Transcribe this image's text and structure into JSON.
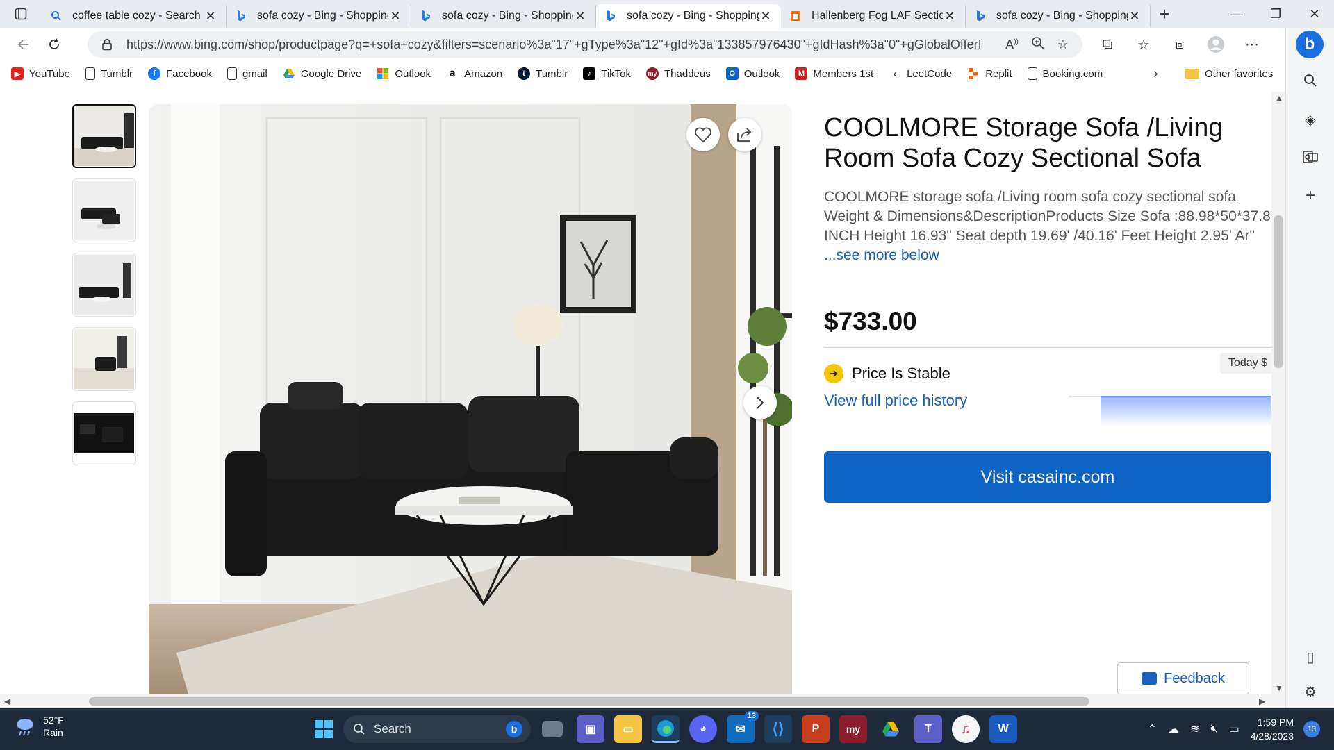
{
  "browser": {
    "tabs": [
      {
        "label": "coffee table cozy - Search",
        "icon": "search-icon"
      },
      {
        "label": "sofa cozy - Bing - Shopping",
        "icon": "bing-icon"
      },
      {
        "label": "sofa cozy - Bing - Shopping",
        "icon": "bing-icon"
      },
      {
        "label": "sofa cozy - Bing - Shopping",
        "icon": "bing-icon",
        "active": true
      },
      {
        "label": "Hallenberg Fog LAF Section",
        "icon": "store-icon"
      },
      {
        "label": "sofa cozy - Bing - Shopping",
        "icon": "bing-icon"
      }
    ],
    "url": "https://www.bing.com/shop/productpage?q=+sofa+cozy&filters=scenario%3a\"17\"+gType%3a\"12\"+gId%3a\"133857976430\"+gIdHash%3a\"0\"+gGlobalOfferI...",
    "favorites": [
      {
        "label": "YouTube",
        "color": "#e62117"
      },
      {
        "label": "Tumblr",
        "color": "#ffffff"
      },
      {
        "label": "Facebook",
        "color": "#1877f2"
      },
      {
        "label": "gmail",
        "color": "#ffffff"
      },
      {
        "label": "Google Drive",
        "color": "#1fa463"
      },
      {
        "label": "Outlook",
        "color": "#f25022"
      },
      {
        "label": "Amazon",
        "color": "#ffffff"
      },
      {
        "label": "Tumblr",
        "color": "#001935"
      },
      {
        "label": "TikTok",
        "color": "#000000"
      },
      {
        "label": "Thaddeus",
        "color": "#8b1d2c"
      },
      {
        "label": "Outlook",
        "color": "#0a64c8"
      },
      {
        "label": "Members 1st",
        "color": "#c81e1e"
      },
      {
        "label": "LeetCode",
        "color": "#ffffff"
      },
      {
        "label": "Replit",
        "color": "#f26207"
      },
      {
        "label": "Booking.com",
        "color": "#ffffff"
      }
    ],
    "other_favorites": "Other favorites"
  },
  "product": {
    "title": "COOLMORE Storage Sofa /Living Room Sofa Cozy Sectional Sofa",
    "description": "COOLMORE storage sofa /Living room sofa cozy sectional sofa Weight & Dimensions&DescriptionProducts Size Sofa :88.98*50*37.8 INCH Height 16.93\" Seat depth 19.69' /40.16' Feet Height 2.95' Ar\" ",
    "see_more": "...see more below",
    "price": "$733.00",
    "price_status": "Price Is Stable",
    "today_label": "Today $",
    "history_link": "View full price history",
    "visit_button": "Visit casainc.com"
  },
  "feedback": "Feedback",
  "taskbar": {
    "weather_temp": "52°F",
    "weather_desc": "Rain",
    "search": "Search",
    "mail_badge": "13",
    "time": "1:59 PM",
    "date": "4/28/2023",
    "notifications": "13"
  }
}
